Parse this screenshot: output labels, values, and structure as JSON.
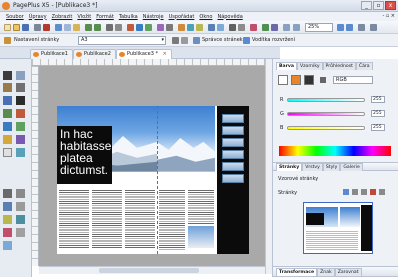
{
  "window": {
    "title": "PagePlus X5 - [Publikace3 *]",
    "controls": {
      "minimize": "_",
      "restore": "▫",
      "close": "x"
    }
  },
  "menu": [
    "Soubor",
    "Úpravy",
    "Zobrazit",
    "Vložit",
    "Formát",
    "Tabulka",
    "Nástroje",
    "Uspořádat",
    "Okno",
    "Nápověda"
  ],
  "menu_right": "- ▫ ×",
  "toolbar": {
    "zoom": "25%",
    "page_setup_label": "Nastavení stránky",
    "page_size": "A3",
    "master_manager": "Správce stránek",
    "layout_guides": "Vodítka rozvržení"
  },
  "doc_tabs": [
    {
      "label": "Publikace1",
      "active": false
    },
    {
      "label": "Publikace2",
      "active": false
    },
    {
      "label": "Publikace3 *",
      "active": true
    }
  ],
  "document": {
    "headline": [
      "In hac",
      "habitasse",
      "platea",
      "dictumst."
    ]
  },
  "right_panel": {
    "color_tabs": [
      "Barva",
      "Vzorníky",
      "Průhlednost",
      "Čára"
    ],
    "color_model": "RGB",
    "sliders": [
      {
        "label": "R",
        "value": "255"
      },
      {
        "label": "G",
        "value": "255"
      },
      {
        "label": "B",
        "value": "255"
      }
    ],
    "pages_tabs": [
      "Stránky",
      "Vrstvy",
      "Styly",
      "Galerie"
    ],
    "master_pages": "Vzorové stránky",
    "pages_label": "Stránky",
    "bottom_tabs": [
      "Transformace",
      "Znak",
      "Zarovnat"
    ]
  },
  "colors": {
    "accent_orange": "#e8852a",
    "selection_blue": "#3c67c9",
    "page_black": "#0b0b0b",
    "canvas_gray": "#a9a9a9"
  }
}
